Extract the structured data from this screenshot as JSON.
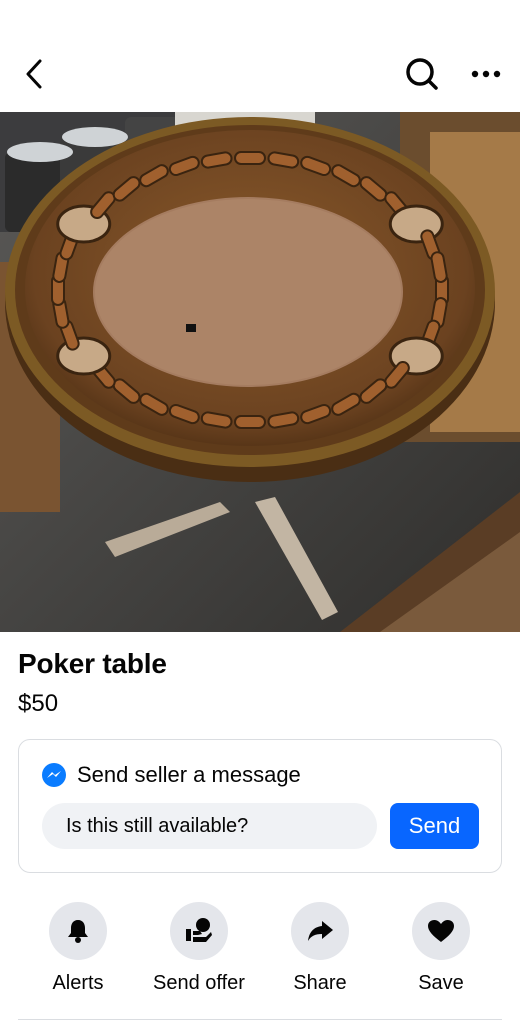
{
  "header": {
    "back_icon": "chevron-left-icon",
    "search_icon": "search-icon",
    "more_icon": "more-horizontal-icon"
  },
  "listing": {
    "title": "Poker table",
    "price": "$50"
  },
  "message": {
    "heading": "Send seller a message",
    "input_value": "Is this still available?",
    "send_label": "Send",
    "accent": "#0866ff"
  },
  "actions": [
    {
      "label": "Alerts",
      "icon": "bell-icon"
    },
    {
      "label": "Send offer",
      "icon": "offer-icon"
    },
    {
      "label": "Share",
      "icon": "share-icon"
    },
    {
      "label": "Save",
      "icon": "heart-icon"
    }
  ]
}
